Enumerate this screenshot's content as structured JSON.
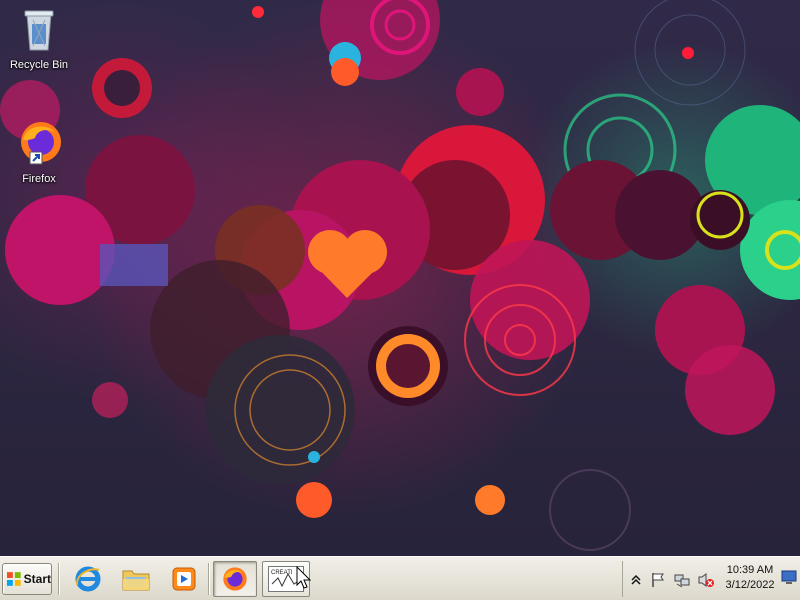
{
  "desktop": {
    "icons": [
      {
        "label": "Recycle Bin",
        "icon": "recycle-bin-icon"
      },
      {
        "label": "Firefox",
        "icon": "firefox-icon"
      }
    ]
  },
  "taskbar": {
    "start_label": "Start",
    "quick_launch": [
      {
        "name": "internet-explorer",
        "icon": "ie-icon"
      },
      {
        "name": "file-explorer",
        "icon": "folder-icon"
      },
      {
        "name": "media-player",
        "icon": "media-player-icon"
      }
    ],
    "tasks": [
      {
        "name": "firefox",
        "icon": "firefox-icon"
      },
      {
        "name": "creative-app",
        "icon": "app-thumbnail-icon",
        "thumb_text": "CREATI"
      }
    ],
    "tray": {
      "icons": [
        "chevron-up-icon",
        "flag-icon",
        "network-icon",
        "volume-muted-icon"
      ],
      "time": "10:39 AM",
      "date": "3/12/2022"
    }
  },
  "colors": {
    "taskbar_bg": "#e6e3d9",
    "wallpaper_bg": "#2c2640",
    "accent_pink": "#e0157a",
    "accent_green": "#2bd08a",
    "accent_orange": "#ff7a2a"
  }
}
